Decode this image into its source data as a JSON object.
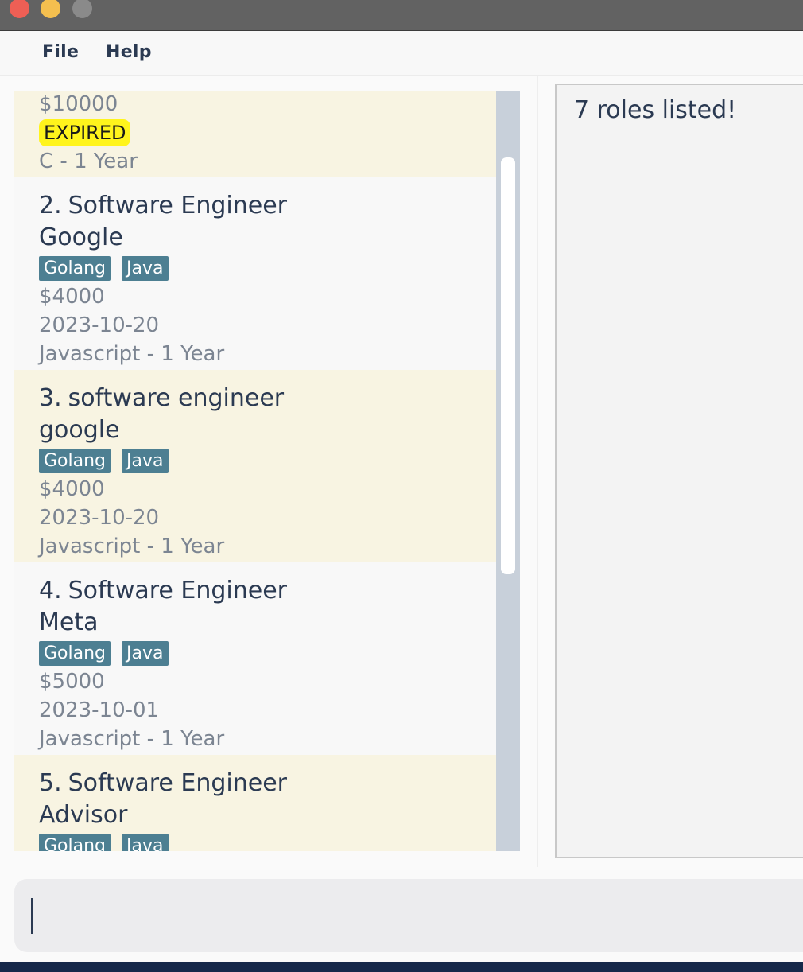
{
  "menu": {
    "file_label": "File",
    "help_label": "Help"
  },
  "roles": [
    {
      "salary": "$10000",
      "status_badge": "EXPIRED",
      "requirement": "C - 1 Year"
    },
    {
      "index": "2.",
      "title": "Software Engineer",
      "company": "Google",
      "tags": [
        "Golang",
        "Java"
      ],
      "salary": "$4000",
      "deadline": "2023-10-20",
      "requirement": "Javascript - 1 Year"
    },
    {
      "index": "3.",
      "title": "software engineer",
      "company": "google",
      "tags": [
        "Golang",
        "Java"
      ],
      "salary": "$4000",
      "deadline": "2023-10-20",
      "requirement": "Javascript - 1 Year"
    },
    {
      "index": "4.",
      "title": "Software Engineer",
      "company": "Meta",
      "tags": [
        "Golang",
        "Java"
      ],
      "salary": "$5000",
      "deadline": "2023-10-01",
      "requirement": "Javascript - 1 Year"
    },
    {
      "index": "5.",
      "title": "Software Engineer",
      "company": "Advisor",
      "tags": [
        "Golang",
        "Java"
      ]
    }
  ],
  "result": {
    "message": "7 roles listed!"
  },
  "command": {
    "value": ""
  },
  "colors": {
    "tag_bg": "#4d7f92",
    "expired_badge": "#fff41c",
    "card_alt": "#f8f4e2",
    "text": "#2b3a52"
  }
}
